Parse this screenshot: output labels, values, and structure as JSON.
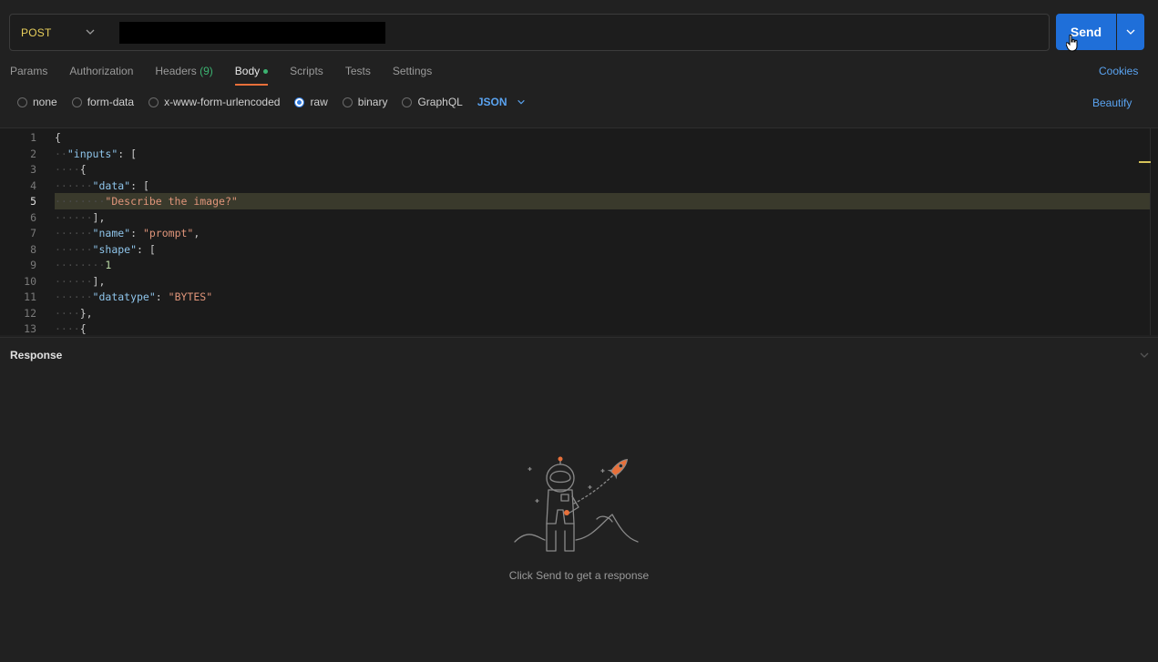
{
  "request": {
    "method": "POST",
    "url_value": "",
    "send_label": "Send"
  },
  "tabs": [
    {
      "label": "Params"
    },
    {
      "label": "Authorization"
    },
    {
      "label": "Headers",
      "count": "(9)"
    },
    {
      "label": "Body"
    },
    {
      "label": "Scripts"
    },
    {
      "label": "Tests"
    },
    {
      "label": "Settings"
    }
  ],
  "cookies_label": "Cookies",
  "body_types": [
    "none",
    "form-data",
    "x-www-form-urlencoded",
    "raw",
    "binary",
    "GraphQL"
  ],
  "selected_body_type": "raw",
  "format_label": "JSON",
  "beautify_label": "Beautify",
  "editor": {
    "line_numbers": [
      "1",
      "2",
      "3",
      "4",
      "5",
      "6",
      "7",
      "8",
      "9",
      "10",
      "11",
      "12",
      "13"
    ],
    "current_line": "5"
  },
  "response": {
    "title": "Response",
    "empty_message": "Click Send to get a response"
  },
  "colors": {
    "accent": "#1f6fd9",
    "tab_underline": "#e8703a",
    "method": "#e8cf5b",
    "link": "#5aa3f0"
  }
}
